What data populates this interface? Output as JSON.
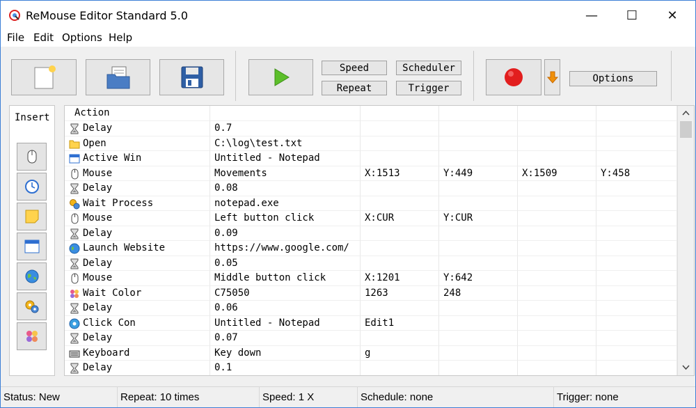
{
  "window": {
    "title": "ReMouse Editor Standard 5.0",
    "minimize": "—",
    "maximize": "☐",
    "close": "✕"
  },
  "menu": [
    "File",
    "Edit",
    "Options",
    "Help"
  ],
  "toolbar": {
    "speed": "Speed",
    "repeat": "Repeat",
    "scheduler": "Scheduler",
    "trigger": "Trigger",
    "options": "Options"
  },
  "insert": {
    "label": "Insert",
    "buttons": [
      "mouse-icon",
      "clock-icon",
      "note-icon",
      "window-icon",
      "globe-icon",
      "gears-icon",
      "color-icon"
    ]
  },
  "table": {
    "header": "Action",
    "rows": [
      {
        "icon": "hourglass-icon",
        "action": "Delay",
        "c2": "0.7",
        "c3": "",
        "c4": "",
        "c5": "",
        "c6": ""
      },
      {
        "icon": "folder-icon",
        "action": "Open",
        "c2": "C:\\log\\test.txt",
        "c3": "",
        "c4": "",
        "c5": "",
        "c6": ""
      },
      {
        "icon": "window-icon",
        "action": "Active Win",
        "c2": "Untitled - Notepad",
        "c3": "",
        "c4": "",
        "c5": "",
        "c6": ""
      },
      {
        "icon": "mouse-icon",
        "action": "Mouse",
        "c2": "Movements",
        "c3": "X:1513",
        "c4": "Y:449",
        "c5": "X:1509",
        "c6": "Y:458"
      },
      {
        "icon": "hourglass-icon",
        "action": "Delay",
        "c2": "0.08",
        "c3": "",
        "c4": "",
        "c5": "",
        "c6": ""
      },
      {
        "icon": "gears-icon",
        "action": "Wait Process",
        "c2": "notepad.exe",
        "c3": "",
        "c4": "",
        "c5": "",
        "c6": ""
      },
      {
        "icon": "mouse-icon",
        "action": "Mouse",
        "c2": "Left button click",
        "c3": "X:CUR",
        "c4": "Y:CUR",
        "c5": "",
        "c6": ""
      },
      {
        "icon": "hourglass-icon",
        "action": "Delay",
        "c2": "0.09",
        "c3": "",
        "c4": "",
        "c5": "",
        "c6": ""
      },
      {
        "icon": "globe-icon",
        "action": "Launch Website",
        "c2": "https://www.google.com/",
        "c3": "",
        "c4": "",
        "c5": "",
        "c6": ""
      },
      {
        "icon": "hourglass-icon",
        "action": "Delay",
        "c2": "0.05",
        "c3": "",
        "c4": "",
        "c5": "",
        "c6": ""
      },
      {
        "icon": "mouse-icon",
        "action": "Mouse",
        "c2": "Middle button click",
        "c3": "X:1201",
        "c4": "Y:642",
        "c5": "",
        "c6": ""
      },
      {
        "icon": "color-icon",
        "action": "Wait Color",
        "c2": "C75050",
        "c3": "1263",
        "c4": "248",
        "c5": "",
        "c6": ""
      },
      {
        "icon": "hourglass-icon",
        "action": "Delay",
        "c2": "0.06",
        "c3": "",
        "c4": "",
        "c5": "",
        "c6": ""
      },
      {
        "icon": "disc-icon",
        "action": "Click Con",
        "c2": "Untitled - Notepad",
        "c3": "Edit1",
        "c4": "",
        "c5": "",
        "c6": ""
      },
      {
        "icon": "hourglass-icon",
        "action": "Delay",
        "c2": "0.07",
        "c3": "",
        "c4": "",
        "c5": "",
        "c6": ""
      },
      {
        "icon": "keyboard-icon",
        "action": "Keyboard",
        "c2": "Key down",
        "c3": "g",
        "c4": "",
        "c5": "",
        "c6": ""
      },
      {
        "icon": "hourglass-icon",
        "action": "Delay",
        "c2": "0.1",
        "c3": "",
        "c4": "",
        "c5": "",
        "c6": ""
      }
    ]
  },
  "status": {
    "status": "Status: New",
    "repeat": "Repeat: 10 times",
    "speed": "Speed: 1 X",
    "schedule": "Schedule: none",
    "trigger": "Trigger: none"
  },
  "colors": {
    "accent": "#3c7fd6",
    "play_green": "#5cbf2a",
    "record_red": "#e21e1e",
    "arrow_orange": "#f0900a",
    "note_yellow": "#ffd34d"
  }
}
